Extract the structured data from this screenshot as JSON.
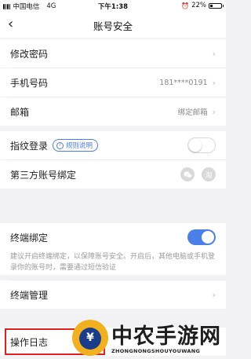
{
  "status_bar": {
    "carrier": "中国电信",
    "network": "4G",
    "time": "下午1:38",
    "battery_percent_text": "22%",
    "battery_level": 0.22
  },
  "nav": {
    "back_icon": "‹",
    "title": "账号安全"
  },
  "rows": {
    "change_password": {
      "label": "修改密码"
    },
    "phone": {
      "label": "手机号码",
      "value": "181****0191"
    },
    "email": {
      "label": "邮箱",
      "value": "绑定邮箱"
    },
    "fingerprint": {
      "label": "指纹登录",
      "rule_button": "规则说明",
      "toggle_on": false
    },
    "third_party": {
      "label": "第三方账号绑定",
      "icons": [
        "wechat-icon",
        "taobao-icon"
      ],
      "taobao_glyph": "淘"
    },
    "device_binding": {
      "label": "终端绑定",
      "toggle_on": true,
      "note": "建议开启终端绑定，以保障账号安全。开启后，其他电脑或手机登录你的账号时，需要通过短信验证"
    },
    "device_management": {
      "label": "终端管理"
    },
    "operation_log": {
      "label": "操作日志"
    }
  },
  "watermark": {
    "title": "中农手游网",
    "subtitle": "ZHONGNONGSHOUYOUWANG"
  },
  "colors": {
    "accent": "#4a7ee8",
    "highlight": "#e02020",
    "background": "#f2f2f4"
  }
}
